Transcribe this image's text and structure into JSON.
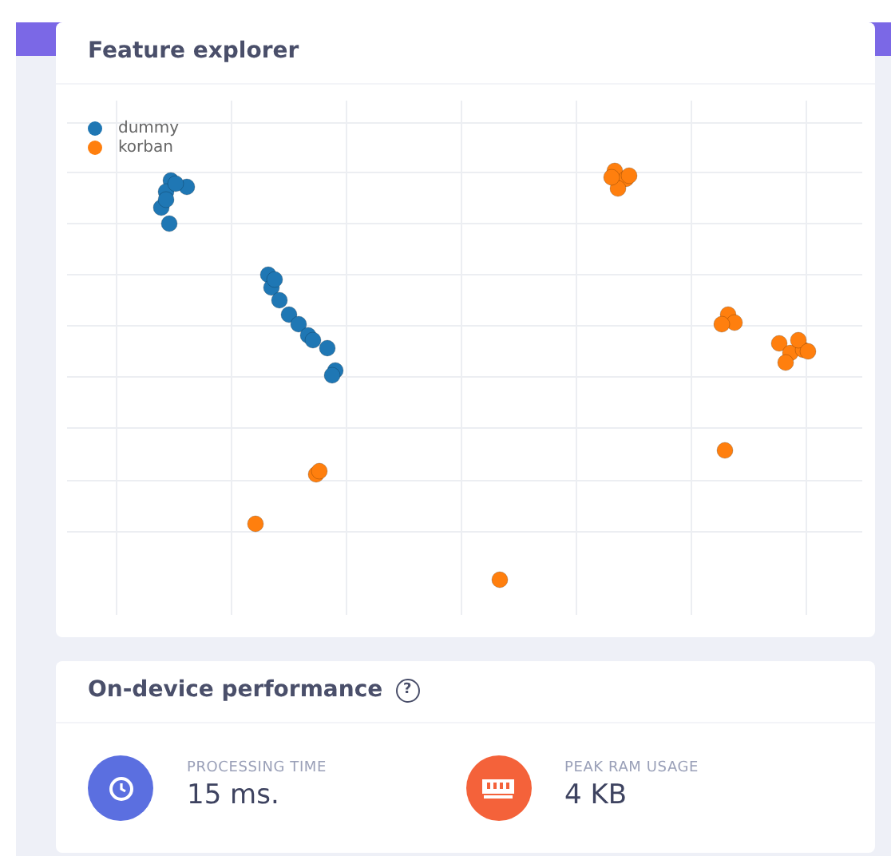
{
  "feature_explorer": {
    "title": "Feature explorer",
    "legend": [
      {
        "label": "dummy",
        "color": "#1f77b4"
      },
      {
        "label": "korban",
        "color": "#ff7f0e"
      }
    ]
  },
  "performance": {
    "title": "On-device performance",
    "help_icon": "?",
    "metrics": [
      {
        "kind": "time",
        "label": "PROCESSING TIME",
        "value": "15 ms.",
        "color": "#5b6fe0"
      },
      {
        "kind": "ram",
        "label": "PEAK RAM USAGE",
        "value": "4 KB",
        "color": "#f4623a"
      }
    ]
  }
}
